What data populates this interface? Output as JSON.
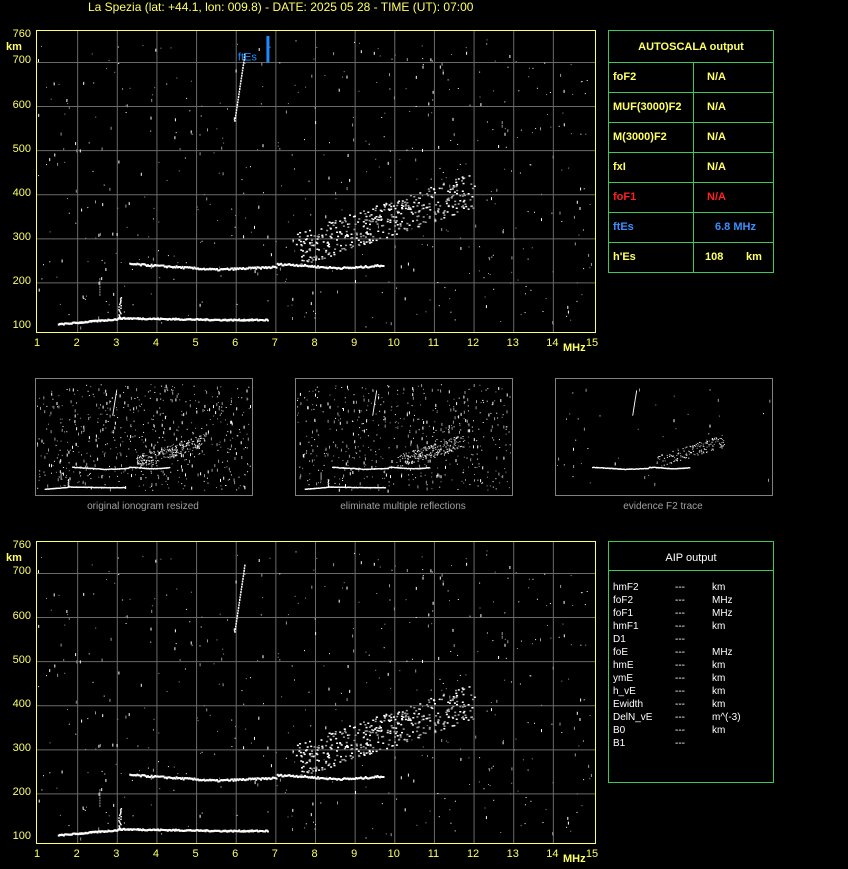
{
  "title": "La Spezia (lat: +44.1, lon: 009.8) - DATE: 2025 05 28 - TIME (UT): 07:00",
  "plot": {
    "y_unit": "km",
    "x_unit": "MHz",
    "y_ticks": [
      "760",
      "700",
      "600",
      "500",
      "400",
      "300",
      "200",
      "100"
    ],
    "x_ticks": [
      "1",
      "2",
      "3",
      "4",
      "5",
      "6",
      "7",
      "8",
      "9",
      "10",
      "11",
      "12",
      "13",
      "14",
      "15"
    ],
    "fte_label": "ftEs",
    "fte_mhz": 6.8,
    "fte_height_top_km": 760,
    "fte_height_bottom_km": 700
  },
  "thumbnails": [
    {
      "caption": "original ionogram resized"
    },
    {
      "caption": "eliminate multiple reflections"
    },
    {
      "caption": "evidence F2 trace"
    }
  ],
  "autoscala": {
    "header": "AUTOSCALA output",
    "rows": [
      {
        "label": "foF2",
        "value": "N/A",
        "unit": "",
        "color": "#ffff66"
      },
      {
        "label": "MUF(3000)F2",
        "value": "N/A",
        "unit": "",
        "color": "#ffff66"
      },
      {
        "label": "M(3000)F2",
        "value": "N/A",
        "unit": "",
        "color": "#ffff66"
      },
      {
        "label": "fxI",
        "value": "N/A",
        "unit": "",
        "color": "#ffff66"
      },
      {
        "label": "foF1",
        "value": "N/A",
        "unit": "",
        "color": "#ff2020"
      },
      {
        "label": "ftEs",
        "value": "6.8 MHz",
        "unit": "",
        "color": "#3a8fff"
      },
      {
        "label": "h'Es",
        "value": "108",
        "unit": "km",
        "color": "#ffff66"
      }
    ]
  },
  "aip": {
    "header": "AIP output",
    "rows": [
      {
        "label": "hmF2",
        "value": "---",
        "unit": "km"
      },
      {
        "label": "foF2",
        "value": "---",
        "unit": "MHz"
      },
      {
        "label": "foF1",
        "value": "---",
        "unit": "MHz"
      },
      {
        "label": "hmF1",
        "value": "---",
        "unit": "km"
      },
      {
        "label": "D1",
        "value": "---",
        "unit": ""
      },
      {
        "label": "foE",
        "value": "---",
        "unit": "MHz"
      },
      {
        "label": "hmE",
        "value": "---",
        "unit": "km"
      },
      {
        "label": "ymE",
        "value": "---",
        "unit": "km"
      },
      {
        "label": "h_vE",
        "value": "---",
        "unit": "km"
      },
      {
        "label": "Ewidth",
        "value": "---",
        "unit": "km"
      },
      {
        "label": "DelN_vE",
        "value": "---",
        "unit": "m^(-3)"
      },
      {
        "label": "B0",
        "value": "---",
        "unit": "km"
      },
      {
        "label": "B1",
        "value": "---",
        "unit": ""
      }
    ]
  },
  "colors": {
    "axis": "#ffff66",
    "grid": "#6a6a6a",
    "panel_border": "#3cc85a",
    "trace": "#ffffff",
    "fte_marker": "#1a8cff"
  }
}
